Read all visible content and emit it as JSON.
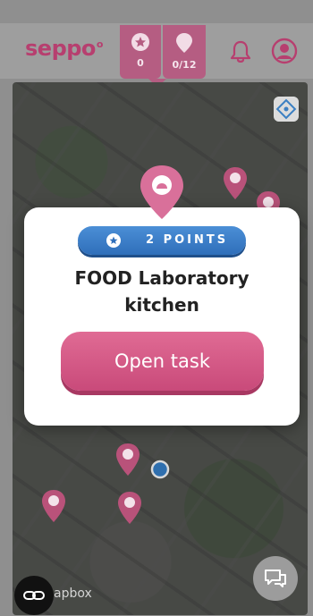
{
  "header": {
    "logo": "seppo",
    "logo_mark": "o",
    "stars_count": "0",
    "tasks_progress": "0/12"
  },
  "modal": {
    "points_label": "2 POINTS",
    "task_title_line1": "FOOD Laboratory",
    "task_title_line2": "kitchen",
    "open_button": "Open task"
  },
  "map": {
    "attribution": "apbox"
  },
  "icons": {
    "stars": "star-icon",
    "tasks": "map-pin-icon",
    "notifications": "bell-icon",
    "profile": "user-icon",
    "chat": "chat-icon",
    "locate": "crosshair-icon"
  },
  "colors": {
    "brand": "#b73f6f",
    "button": "#d75a86",
    "badge_blue": "#3a7fc8"
  }
}
